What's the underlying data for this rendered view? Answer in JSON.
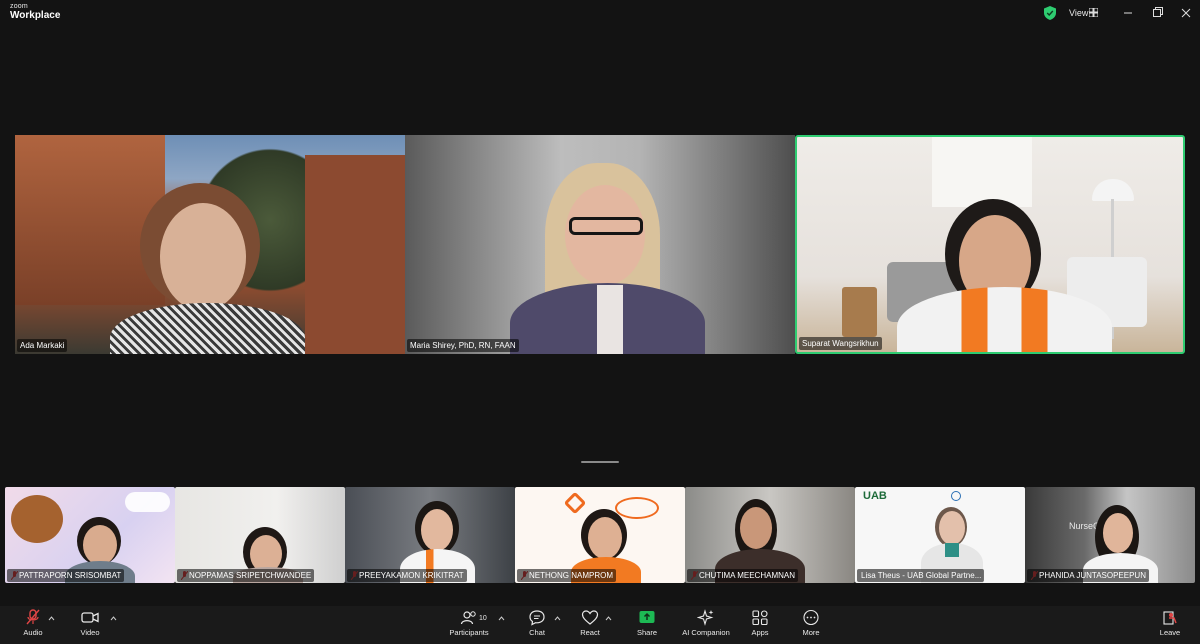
{
  "app": {
    "logo_line1": "zoom",
    "logo_line2": "Workplace",
    "view_label": "View"
  },
  "colors": {
    "active_speaker_border": "#2ecc71",
    "shield": "#2ecc71",
    "muted_mic": "#e04545",
    "share": "#1db954"
  },
  "main_tiles": [
    {
      "name": "Ada Markaki"
    },
    {
      "name": "Maria Shirey, PhD, RN, FAAN"
    },
    {
      "name": "Suparat Wangsrikhun"
    }
  ],
  "thumbnails": [
    {
      "name": "PATTRAPORN SRISOMBAT"
    },
    {
      "name": "NOPPAMAS SRIPETCHWANDEE"
    },
    {
      "name": "PREEYAKAMON KRIKITRAT"
    },
    {
      "name": "NETHONG NAMPROM"
    },
    {
      "name": "CHUTIMA MEECHAMNAN"
    },
    {
      "name": "Lisa Theus - UAB Global Partne..."
    },
    {
      "name": "PHANIDA JUNTASOPEEPUN"
    }
  ],
  "thumb_texts": {
    "uab": "UAB",
    "nurse": "NurseCM"
  },
  "toolbar": {
    "audio": "Audio",
    "video": "Video",
    "participants": "Participants",
    "participants_count": "10",
    "chat": "Chat",
    "react": "React",
    "share": "Share",
    "ai_companion": "AI Companion",
    "apps": "Apps",
    "more": "More",
    "leave": "Leave"
  }
}
